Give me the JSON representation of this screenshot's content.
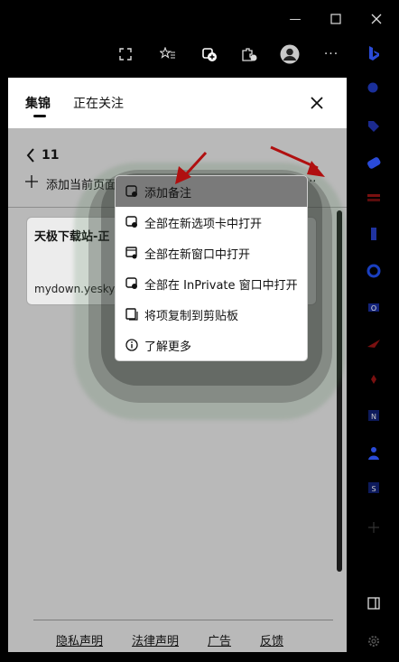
{
  "window_controls": {
    "minimize": "—",
    "maximize": "☐",
    "close": "✕"
  },
  "toolbar": {
    "more_label": "···"
  },
  "panel": {
    "tabs": [
      "集锦",
      "正在关注"
    ],
    "close_label": "✕",
    "collection": {
      "count": "11",
      "add_page_label": "添加当前页面",
      "more_label": "···"
    },
    "card": {
      "title": "天极下载站-正",
      "url": "mydown.yesky."
    },
    "footer_links": [
      "隐私声明",
      "法律声明",
      "广告",
      "反馈"
    ]
  },
  "context_menu": {
    "items": [
      {
        "label": "添加备注",
        "icon": "note-icon",
        "highlighted": true
      },
      {
        "label": "全部在新选项卡中打开",
        "icon": "tab-icon",
        "highlighted": false
      },
      {
        "label": "全部在新窗口中打开",
        "icon": "window-icon",
        "highlighted": false
      },
      {
        "label": "全部在 InPrivate 窗口中打开",
        "icon": "inprivate-icon",
        "highlighted": false
      },
      {
        "label": "将项复制到剪贴板",
        "icon": "copy-icon",
        "highlighted": false
      },
      {
        "label": "了解更多",
        "icon": "info-icon",
        "highlighted": false
      }
    ]
  },
  "colors": {
    "accent_arrow": "#b01010",
    "sidebar_blue": "#2a4bd8"
  }
}
